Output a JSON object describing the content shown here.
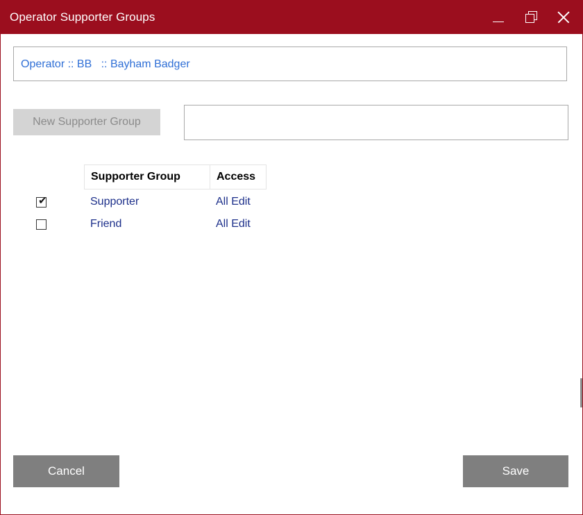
{
  "window": {
    "title": "Operator Supporter Groups",
    "accent_color": "#9b0e1e",
    "controls": [
      "minimize-icon",
      "maximize-icon",
      "close-icon"
    ]
  },
  "operator": {
    "label": "Operator :: BB   :: Bayham Badger"
  },
  "new_group": {
    "button_label": "New Supporter Group",
    "input_value": ""
  },
  "table": {
    "columns": [
      "Supporter Group",
      "Access"
    ],
    "rows": [
      {
        "checked": true,
        "group": "Supporter",
        "access": "All Edit"
      },
      {
        "checked": false,
        "group": "Friend",
        "access": "All Edit"
      }
    ]
  },
  "footer": {
    "cancel_label": "Cancel",
    "save_label": "Save"
  }
}
